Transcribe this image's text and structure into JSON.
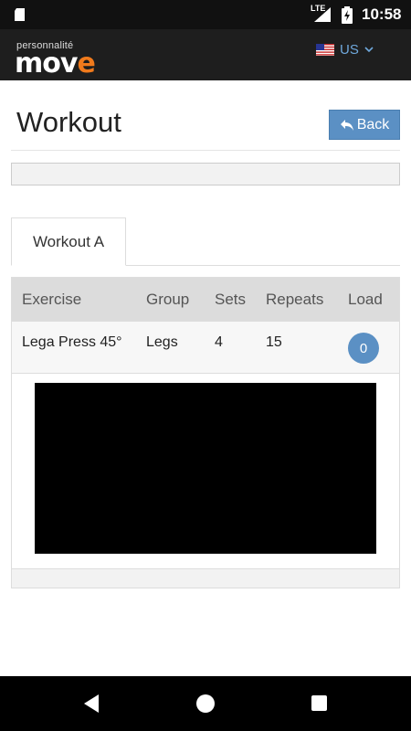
{
  "status_bar": {
    "time": "10:58",
    "network": "LTE",
    "icons": [
      "sd-card-icon",
      "signal-icon",
      "battery-icon"
    ]
  },
  "header": {
    "logo_small": "personnalité",
    "logo_main": "mov",
    "logo_accent": "e",
    "language": "US"
  },
  "page": {
    "title": "Workout",
    "back_label": "Back",
    "progress_percent": 0
  },
  "tabs": [
    {
      "label": "Workout A",
      "active": true
    }
  ],
  "table": {
    "columns": [
      "Exercise",
      "Group",
      "Sets",
      "Repeats",
      "Load"
    ],
    "rows": [
      {
        "exercise": "Lega Press 45°",
        "group": "Legs",
        "sets": "4",
        "repeats": "15",
        "load": "0"
      }
    ]
  },
  "colors": {
    "accent": "#5b90c4",
    "header_bg": "#1e1e1e",
    "logo_accent": "#f07a1c"
  }
}
